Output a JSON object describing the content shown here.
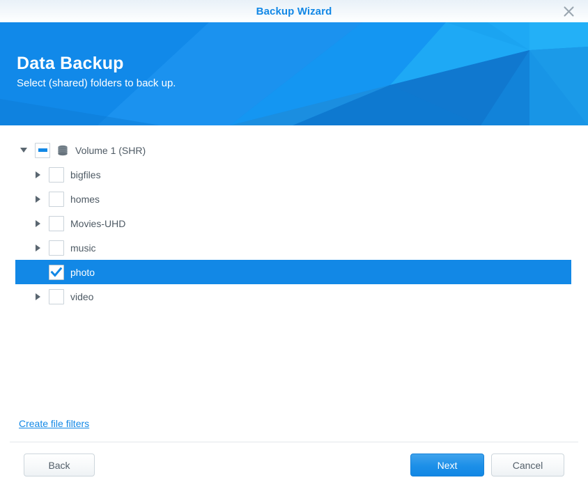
{
  "window": {
    "title": "Backup Wizard",
    "close_icon": "close-x-icon"
  },
  "banner": {
    "title": "Data Backup",
    "subtitle": "Select (shared) folders to back up.",
    "background_color": "#1289e8"
  },
  "tree": {
    "root": {
      "label": "Volume 1 (SHR)",
      "icon": "volume-disk-icon",
      "expanded": true,
      "checkbox_state": "indeterminate",
      "arrow": "chevron-down-icon"
    },
    "children": [
      {
        "label": "bigfiles",
        "checkbox_state": "unchecked",
        "expandable": true,
        "selected": false,
        "arrow": "chevron-right-icon"
      },
      {
        "label": "homes",
        "checkbox_state": "unchecked",
        "expandable": true,
        "selected": false,
        "arrow": "chevron-right-icon"
      },
      {
        "label": "Movies-UHD",
        "checkbox_state": "unchecked",
        "expandable": true,
        "selected": false,
        "arrow": "chevron-right-icon"
      },
      {
        "label": "music",
        "checkbox_state": "unchecked",
        "expandable": true,
        "selected": false,
        "arrow": "chevron-right-icon"
      },
      {
        "label": "photo",
        "checkbox_state": "checked",
        "expandable": false,
        "selected": true,
        "arrow": ""
      },
      {
        "label": "video",
        "checkbox_state": "unchecked",
        "expandable": true,
        "selected": false,
        "arrow": "chevron-right-icon"
      }
    ]
  },
  "links": {
    "create_file_filters": "Create file filters"
  },
  "footer": {
    "back_label": "Back",
    "next_label": "Next",
    "cancel_label": "Cancel"
  },
  "colors": {
    "accent": "#1288e6",
    "selection": "#1288e6",
    "text": "#4e5a64",
    "link": "#1288e6"
  }
}
